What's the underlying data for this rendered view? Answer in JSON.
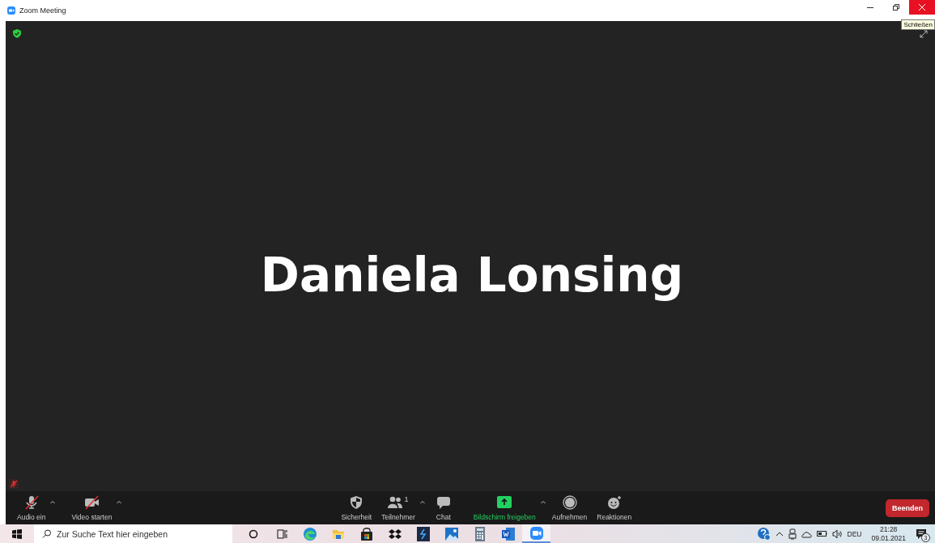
{
  "window": {
    "title": "Zoom Meeting",
    "close_tooltip": "Schließen"
  },
  "meeting": {
    "participant_name": "Daniela Lonsing"
  },
  "toolbar": {
    "items": [
      {
        "kind": "audio",
        "label": "Audio ein",
        "muted": true,
        "highlighted": false,
        "caret": true
      },
      {
        "kind": "video",
        "label": "Video starten",
        "muted": true,
        "highlighted": false,
        "caret": true
      },
      {
        "kind": "security",
        "label": "Sicherheit",
        "muted": false,
        "highlighted": false,
        "caret": false
      },
      {
        "kind": "participants",
        "label": "Teilnehmer",
        "count": "1",
        "muted": false,
        "highlighted": false,
        "caret": true
      },
      {
        "kind": "chat",
        "label": "Chat",
        "muted": false,
        "highlighted": false,
        "caret": false
      },
      {
        "kind": "share",
        "label": "Bildschirm freigeben",
        "muted": false,
        "highlighted": true,
        "caret": true
      },
      {
        "kind": "record",
        "label": "Aufnehmen",
        "muted": false,
        "highlighted": false,
        "caret": false
      },
      {
        "kind": "reactions",
        "label": "Reaktionen",
        "muted": false,
        "highlighted": false,
        "caret": false
      }
    ],
    "end_button": "Beenden"
  },
  "taskbar": {
    "search_placeholder": "Zur Suche Text hier eingeben",
    "apps": [
      {
        "kind": "cortana",
        "selected": false
      },
      {
        "kind": "taskview",
        "selected": false
      },
      {
        "kind": "edge",
        "selected": false
      },
      {
        "kind": "explorer",
        "selected": false
      },
      {
        "kind": "store",
        "selected": false
      },
      {
        "kind": "dropbox",
        "selected": false
      },
      {
        "kind": "terminal",
        "selected": false
      },
      {
        "kind": "photos",
        "selected": false
      },
      {
        "kind": "calculator",
        "selected": false
      },
      {
        "kind": "word",
        "selected": false
      },
      {
        "kind": "zoom",
        "selected": true
      }
    ],
    "tray": {
      "language": "DEU",
      "time": "21:28",
      "date": "09.01.2021",
      "notification_count": "3"
    }
  }
}
